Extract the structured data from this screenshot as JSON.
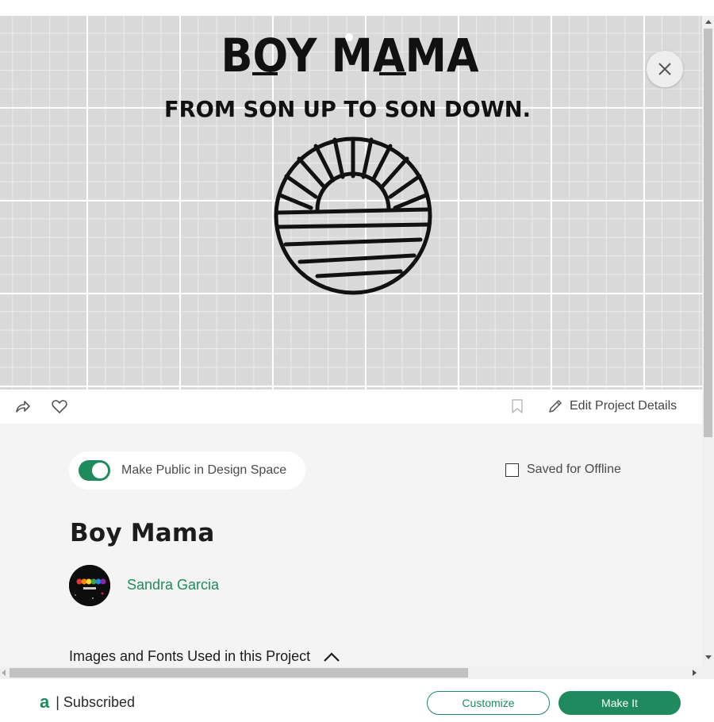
{
  "design": {
    "title_line": "BOY MAMA",
    "subtitle_line": "FROM SON UP TO SON DOWN."
  },
  "actions": {
    "edit_details_label": "Edit Project Details"
  },
  "details": {
    "make_public_label": "Make Public in Design Space",
    "make_public_on": true,
    "saved_offline_label": "Saved for Offline",
    "saved_offline_checked": false,
    "project_title": "Boy Mama",
    "author_name": "Sandra Garcia",
    "images_fonts_label": "Images and Fonts Used in this Project"
  },
  "footer": {
    "logo_glyph": "a",
    "subscription_status": "| Subscribed",
    "customize_label": "Customize",
    "make_it_label": "Make It"
  },
  "colors": {
    "accent": "#1e8a5d",
    "canvas_bg": "#d9d9d9",
    "panel_bg": "#f4f4f4"
  },
  "icons": [
    "close-icon",
    "share-icon",
    "heart-icon",
    "bookmark-icon",
    "pencil-icon",
    "chevron-up-icon"
  ]
}
